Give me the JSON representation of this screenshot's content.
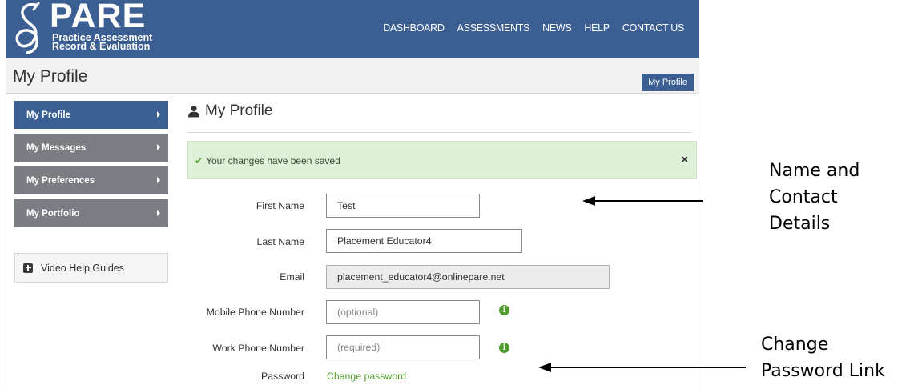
{
  "brand": {
    "name": "PARE",
    "subtitle_line1": "Practice Assessment",
    "subtitle_line2": "Record & Evaluation"
  },
  "nav": [
    "DASHBOARD",
    "ASSESSMENTS",
    "NEWS",
    "HELP",
    "CONTACT US"
  ],
  "titlebar": {
    "title": "My Profile",
    "button": "My Profile"
  },
  "sidebar": {
    "items": [
      {
        "label": "My Profile",
        "active": true
      },
      {
        "label": "My Messages",
        "active": false
      },
      {
        "label": "My Preferences",
        "active": false
      },
      {
        "label": "My Portfolio",
        "active": false
      }
    ],
    "help": "Video Help Guides"
  },
  "main": {
    "heading": "My Profile",
    "alert": {
      "text": "Your changes have been saved",
      "close": "×"
    },
    "form": {
      "first_name": {
        "label": "First Name",
        "value": "Test"
      },
      "last_name": {
        "label": "Last Name",
        "value": "Placement Educator4"
      },
      "email": {
        "label": "Email",
        "value": "placement_educator4@onlinepare.net"
      },
      "mobile": {
        "label": "Mobile Phone Number",
        "placeholder": "(optional)"
      },
      "work": {
        "label": "Work Phone Number",
        "placeholder": "(required)"
      },
      "password": {
        "label": "Password",
        "link": "Change password"
      }
    }
  },
  "annotations": {
    "name_contact": [
      "Name and",
      "Contact",
      "Details"
    ],
    "change_password": [
      "Change",
      "Password Link"
    ]
  },
  "colors": {
    "brand_blue": "#3b5f93",
    "success_green": "#dff0d8",
    "link_green": "#4f9c2c",
    "sidebar_grey": "#7a7e82"
  }
}
